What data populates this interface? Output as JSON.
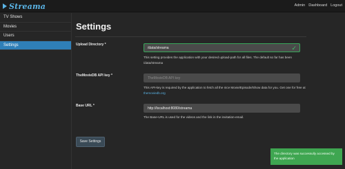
{
  "brand": {
    "name": "Streama"
  },
  "topnav": [
    "Admin",
    "Dashboard",
    "Logout"
  ],
  "sidebar": {
    "items": [
      {
        "label": "TV Shows"
      },
      {
        "label": "Movies"
      },
      {
        "label": "Users"
      },
      {
        "label": "Settings"
      }
    ]
  },
  "page": {
    "title": "Settings"
  },
  "settings": [
    {
      "label": "Upload Directory *",
      "value": "/data/streama",
      "placeholder": "",
      "valid": true,
      "help": "This setting provides the application with your desired upload-path for all files. The default so far has been /data/streama"
    },
    {
      "label": "TheMovieDB API key *",
      "value": "",
      "placeholder": "TheMovieDB API key",
      "valid": false,
      "help": "This API-key is required by the application to fetch all the nice Movie/Episode/Show data for you. Get one for free at ",
      "help_link": "themoviedb.org"
    },
    {
      "label": "Base URL *",
      "value": "http://localhost:8080/streama",
      "placeholder": "",
      "valid": false,
      "help": "The Base-URL is used for the videos and the link in the invitation-email."
    }
  ],
  "actions": {
    "save_label": "Save Settings"
  },
  "toast": {
    "message": "The directory was successully accessed by the application"
  },
  "colors": {
    "accent": "#2f7fb8",
    "brand": "#5ab4e6",
    "success": "#3fa651"
  },
  "icons": {
    "brand": "play-icon",
    "valid": "checkmark-icon"
  }
}
